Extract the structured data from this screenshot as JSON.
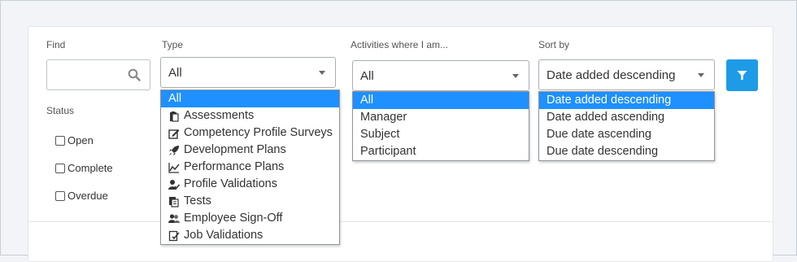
{
  "find": {
    "label": "Find",
    "value": "",
    "placeholder": ""
  },
  "type": {
    "label": "Type",
    "selected": "All",
    "options": [
      {
        "label": "All",
        "icon": ""
      },
      {
        "label": "Assessments",
        "icon": "clipboard-icon"
      },
      {
        "label": "Competency Profile Surveys",
        "icon": "edit-icon"
      },
      {
        "label": "Development Plans",
        "icon": "rocket-icon"
      },
      {
        "label": "Performance Plans",
        "icon": "line-chart-icon"
      },
      {
        "label": "Profile Validations",
        "icon": "user-check-icon"
      },
      {
        "label": "Tests",
        "icon": "test-sheet-icon"
      },
      {
        "label": "Employee Sign-Off",
        "icon": "users-icon"
      },
      {
        "label": "Job Validations",
        "icon": "checklist-icon"
      }
    ]
  },
  "activities": {
    "label": "Activities where I am...",
    "selected": "All",
    "options": [
      "All",
      "Manager",
      "Subject",
      "Participant"
    ]
  },
  "sort": {
    "label": "Sort by",
    "selected": "Date added descending",
    "options": [
      "Date added descending",
      "Date added ascending",
      "Due date ascending",
      "Due date descending"
    ]
  },
  "status": {
    "label": "Status",
    "options": [
      "Open",
      "Complete",
      "Overdue"
    ]
  },
  "colors": {
    "accent": "#1e9be6",
    "selection": "#1e90ff"
  }
}
